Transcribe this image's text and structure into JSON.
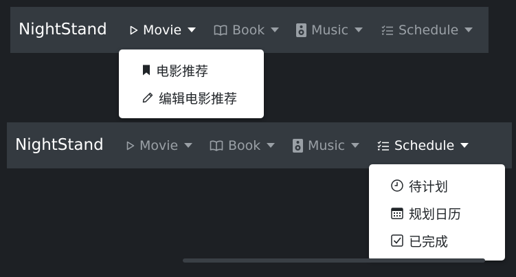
{
  "navbar_top": {
    "brand": "NightStand",
    "items": [
      {
        "label": "Movie",
        "icon": "play-outline-icon",
        "active": true
      },
      {
        "label": "Book",
        "icon": "book-icon",
        "active": false
      },
      {
        "label": "Music",
        "icon": "speaker-icon",
        "active": false
      },
      {
        "label": "Schedule",
        "icon": "list-check-icon",
        "active": false
      }
    ],
    "dropdown": {
      "owner": "Movie",
      "items": [
        {
          "label": "电影推荐",
          "icon": "bookmark-icon"
        },
        {
          "label": "编辑电影推荐",
          "icon": "pencil-icon"
        }
      ]
    }
  },
  "navbar_bottom": {
    "brand": "NightStand",
    "items": [
      {
        "label": "Movie",
        "icon": "play-outline-icon",
        "active": false
      },
      {
        "label": "Book",
        "icon": "book-icon",
        "active": false
      },
      {
        "label": "Music",
        "icon": "speaker-icon",
        "active": false
      },
      {
        "label": "Schedule",
        "icon": "list-check-icon",
        "active": true
      }
    ],
    "dropdown": {
      "owner": "Schedule",
      "items": [
        {
          "label": "待计划",
          "icon": "clock-icon"
        },
        {
          "label": "规划日历",
          "icon": "calendar-icon"
        },
        {
          "label": "已完成",
          "icon": "check-square-icon"
        }
      ]
    }
  },
  "colors": {
    "page_background": "#1d2024",
    "navbar_background": "#343a40",
    "active_text": "#ffffff",
    "inactive_text": "#9aa0a6",
    "dropdown_background": "#ffffff",
    "dropdown_text": "#212529"
  }
}
